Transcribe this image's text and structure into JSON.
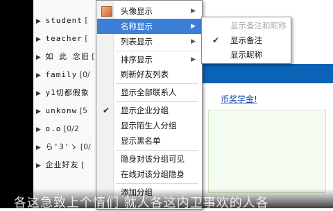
{
  "contacts": {
    "groups": [
      {
        "name": "student",
        "count": "["
      },
      {
        "name": "teacher",
        "count": "["
      },
      {
        "name": "如 此 念旧",
        "count": "["
      },
      {
        "name": "family",
        "count": "[0/"
      },
      {
        "name": "y1切都假象",
        "count": ""
      },
      {
        "name": "unkonw",
        "count": "[5"
      },
      {
        "name": "o.o",
        "count": "[0/2"
      },
      {
        "name": "ら'3'ゝ",
        "count": "[0/"
      },
      {
        "name": "企业好友",
        "count": "["
      }
    ]
  },
  "context_menu": {
    "items": [
      {
        "label": "头像显示",
        "submenu": true
      },
      {
        "label": "名称显示",
        "submenu": true,
        "highlighted": true
      },
      {
        "label": "列表显示",
        "submenu": true
      },
      {
        "label": "排序显示",
        "submenu": true
      },
      {
        "label": "刷新好友列表"
      },
      {
        "label": "显示全部联系人"
      },
      {
        "label": "显示企业分组",
        "checked": true
      },
      {
        "label": "显示陌生人分组"
      },
      {
        "label": "显示黑名单"
      },
      {
        "label": "隐身对该分组可见"
      },
      {
        "label": "在线对该分组隐身"
      },
      {
        "label": "添加分组"
      }
    ]
  },
  "name_submenu": {
    "items": [
      {
        "label": "显示备注和昵称",
        "disabled": true
      },
      {
        "label": "显示备注",
        "checked": true
      },
      {
        "label": "显示昵称"
      }
    ]
  },
  "background": {
    "link_text": "币奖学金!",
    "caption": "各这急致上个情们 就人各这内卫事欢的人各"
  },
  "colors": {
    "highlight": "#3c7fd6",
    "blue_bar": "#0b63b6"
  }
}
